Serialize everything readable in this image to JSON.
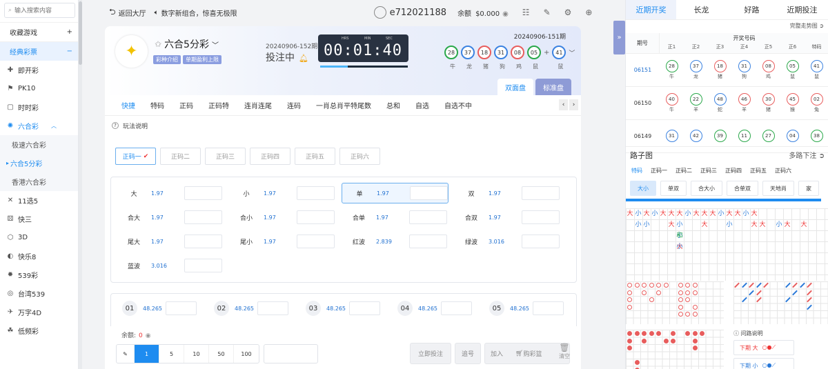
{
  "sidebar": {
    "search_placeholder": "输入搜索内容",
    "groups": [
      {
        "label": "收藏游戏",
        "sign": "+"
      },
      {
        "label": "经典彩票",
        "sign": "−"
      }
    ],
    "items": [
      {
        "label": "即开彩",
        "icon": "✚"
      },
      {
        "label": "PK10",
        "icon": "⚑"
      },
      {
        "label": "时时彩",
        "icon": "▢"
      },
      {
        "label": "六合彩",
        "icon": "✺"
      },
      {
        "label": "11选5",
        "icon": "✕"
      },
      {
        "label": "快三",
        "icon": "⚄"
      },
      {
        "label": "3D",
        "icon": "⬡"
      },
      {
        "label": "快乐8",
        "icon": "◐"
      },
      {
        "label": "539彩",
        "icon": "✹"
      },
      {
        "label": "台湾539",
        "icon": "◎"
      },
      {
        "label": "万字4D",
        "icon": "✈"
      },
      {
        "label": "低频彩",
        "icon": "☘"
      }
    ],
    "subs": [
      "极速六合彩",
      "六合5分彩",
      "香港六合彩"
    ]
  },
  "topbar": {
    "back_label": "返回大厅",
    "notice": "数字新组合，惊喜无极限",
    "username": "e712021188",
    "balance_label": "余额",
    "balance_value": "$0.000"
  },
  "game": {
    "title": "六合5分彩",
    "tag_intro": "彩种介绍",
    "tag_profit": "单期盈利上限",
    "current_issue": "20240906-152期",
    "status": "投注中",
    "clock_labels": {
      "hrs": "HRS",
      "min": "MIN",
      "sec": "SEC"
    },
    "countdown": "00:01:40",
    "prev_issue": "20240906-151期",
    "balls": [
      {
        "n": "28",
        "z": "牛",
        "c": "g"
      },
      {
        "n": "37",
        "z": "龙",
        "c": "b"
      },
      {
        "n": "18",
        "z": "猪",
        "c": "r"
      },
      {
        "n": "31",
        "z": "狗",
        "c": "b"
      },
      {
        "n": "08",
        "z": "鸡",
        "c": "r"
      },
      {
        "n": "05",
        "z": "鼠",
        "c": "g"
      },
      {
        "n": "41",
        "z": "鼠",
        "c": "b"
      }
    ],
    "mode_tabs": [
      "双面盘",
      "标准盘"
    ]
  },
  "play_tabs": [
    "快捷",
    "特码",
    "正码",
    "正码特",
    "连肖连尾",
    "连码",
    "一肖总肖平特尾数",
    "总和",
    "自选",
    "自选不中"
  ],
  "howto_label": "玩法说明",
  "zm_tabs": [
    "正码一",
    "正码二",
    "正码三",
    "正码四",
    "正码五",
    "正码六"
  ],
  "bets": [
    {
      "name": "大",
      "odds": "1.97"
    },
    {
      "name": "小",
      "odds": "1.97"
    },
    {
      "name": "单",
      "odds": "1.97"
    },
    {
      "name": "双",
      "odds": "1.97"
    },
    {
      "name": "合大",
      "odds": "1.97"
    },
    {
      "name": "合小",
      "odds": "1.97"
    },
    {
      "name": "合单",
      "odds": "1.97"
    },
    {
      "name": "合双",
      "odds": "1.97"
    },
    {
      "name": "尾大",
      "odds": "1.97"
    },
    {
      "name": "尾小",
      "odds": "1.97"
    },
    {
      "name": "红波",
      "odds": "2.839"
    },
    {
      "name": "绿波",
      "odds": "3.016"
    },
    {
      "name": "蓝波",
      "odds": "3.016"
    }
  ],
  "numbers": [
    {
      "n": "01",
      "odds": "48.265"
    },
    {
      "n": "02",
      "odds": "48.265"
    },
    {
      "n": "03",
      "odds": "48.265"
    },
    {
      "n": "04",
      "odds": "48.265"
    },
    {
      "n": "05",
      "odds": "48.265"
    }
  ],
  "footer": {
    "balance_label": "余额:",
    "balance_value": "0",
    "chips": [
      "1",
      "5",
      "10",
      "50",
      "100"
    ],
    "btn_now": "立即投注",
    "btn_chase": "追号",
    "btn_add": "加入",
    "btn_cart": "购彩篮",
    "btn_clear": "清空"
  },
  "right": {
    "tabs": [
      "近期开奖",
      "长龙",
      "好路",
      "近期投注"
    ],
    "trend_link": "完整走势图",
    "col_issue": "期号",
    "col_nums": "开奖号码",
    "col_heads": [
      "正1",
      "正2",
      "正3",
      "正4",
      "正5",
      "正6",
      "特码"
    ],
    "rows": [
      {
        "q": "06151",
        "balls": [
          {
            "n": "28",
            "z": "牛",
            "c": "g"
          },
          {
            "n": "37",
            "z": "龙",
            "c": "bl"
          },
          {
            "n": "18",
            "z": "猪",
            "c": "r"
          },
          {
            "n": "31",
            "z": "狗",
            "c": "bl"
          },
          {
            "n": "08",
            "z": "鸡",
            "c": "r"
          },
          {
            "n": "05",
            "z": "鼠",
            "c": "g"
          },
          {
            "n": "41",
            "z": "鼠",
            "c": "bl"
          }
        ]
      },
      {
        "q": "06150",
        "balls": [
          {
            "n": "40",
            "z": "牛",
            "c": "r"
          },
          {
            "n": "22",
            "z": "羊",
            "c": "g"
          },
          {
            "n": "48",
            "z": "蛇",
            "c": "bl"
          },
          {
            "n": "46",
            "z": "羊",
            "c": "r"
          },
          {
            "n": "30",
            "z": "猪",
            "c": "r"
          },
          {
            "n": "45",
            "z": "猴",
            "c": "r"
          },
          {
            "n": "02",
            "z": "兔",
            "c": "r"
          }
        ]
      },
      {
        "q": "06149",
        "balls": [
          {
            "n": "31",
            "z": "",
            "c": "bl"
          },
          {
            "n": "42",
            "z": "",
            "c": "bl"
          },
          {
            "n": "39",
            "z": "",
            "c": "g"
          },
          {
            "n": "11",
            "z": "",
            "c": "g"
          },
          {
            "n": "27",
            "z": "",
            "c": "g"
          },
          {
            "n": "04",
            "z": "",
            "c": "bl"
          },
          {
            "n": "38",
            "z": "",
            "c": "g"
          }
        ]
      }
    ],
    "road_title": "路子图",
    "road_multi": "多路下注",
    "road_tabs": [
      "特码",
      "正码一",
      "正码二",
      "正码三",
      "正码四",
      "正码五",
      "正码六"
    ],
    "road_opts": [
      "大小",
      "单双",
      "合大小",
      "合单双",
      "天地肖",
      "家"
    ],
    "road_chars": [
      "大",
      "小",
      "大",
      "小",
      "大",
      "大",
      "大",
      "小",
      "大",
      "大",
      "大",
      "小",
      "大",
      "大",
      "小",
      "大",
      "小",
      "小",
      "大",
      "小",
      "大",
      "小",
      "大",
      "大",
      "小",
      "大",
      "大",
      "小",
      "大",
      "和",
      "小"
    ],
    "legend_label": "问路说明",
    "next_big": "下期 大",
    "next_small": "下期 小"
  },
  "colors": {
    "accent": "#1e8cf0",
    "red": "#e85d5d",
    "green": "#2aa84a",
    "blue": "#3b82e0"
  }
}
